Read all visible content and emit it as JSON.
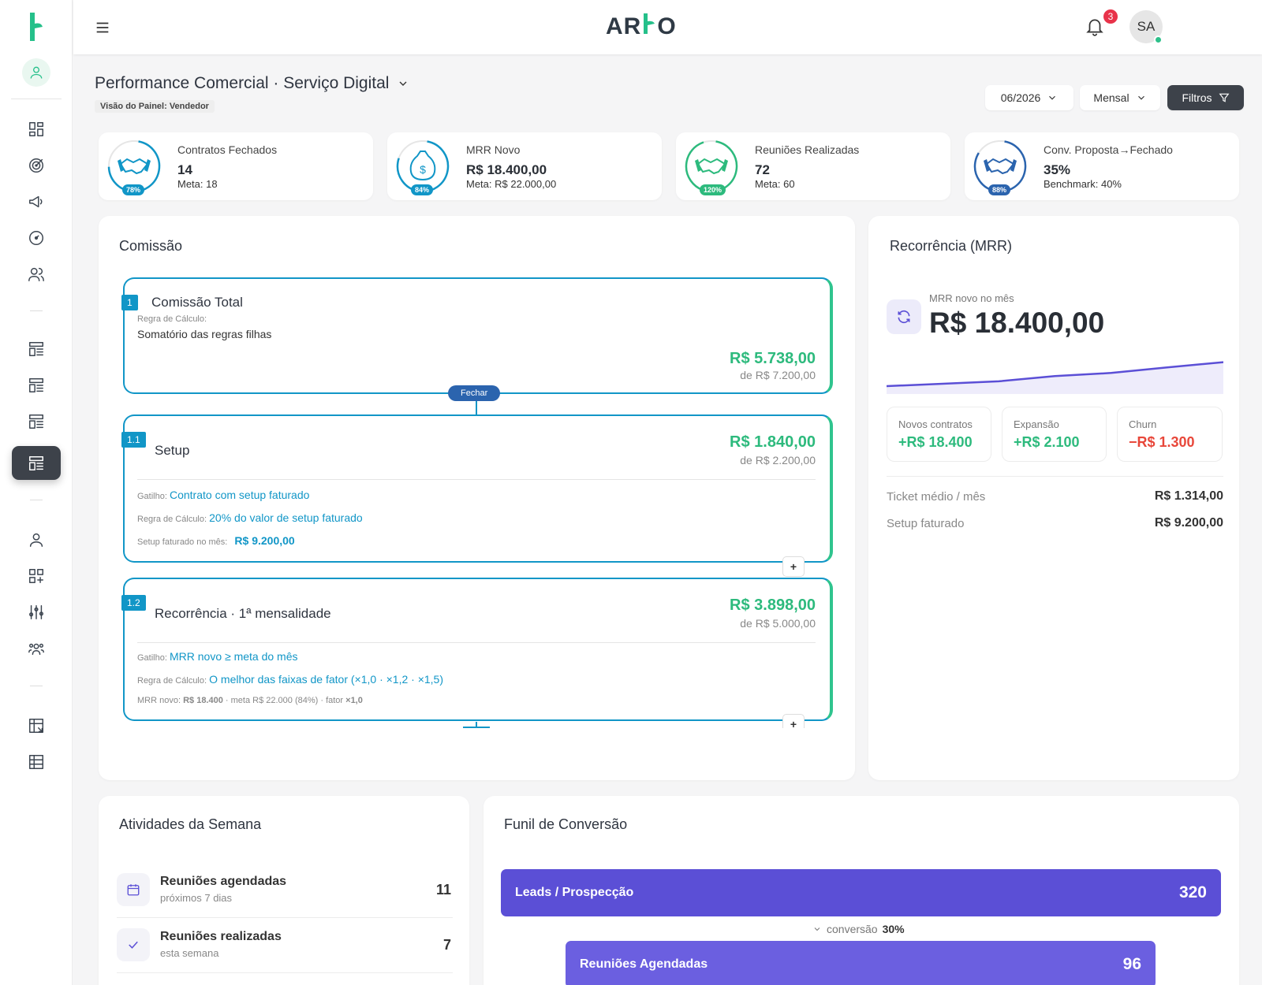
{
  "header": {
    "brand_left": "AR",
    "brand_right": "O",
    "notifications": "3",
    "user_initials": "SA"
  },
  "page": {
    "title": "Performance Comercial · Serviço Digital",
    "view_badge": "Visão do Painel: Vendedor",
    "period": "06/2026",
    "granularity": "Mensal",
    "filters_label": "Filtros"
  },
  "kpis": [
    {
      "label": "Contratos Fechados",
      "value": "14",
      "sub": "Meta: 18",
      "pct": "78%",
      "progress": 0.78,
      "color": "#1196c7"
    },
    {
      "label": "MRR Novo",
      "value": "R$ 18.400,00",
      "sub": "Meta: R$ 22.000,00",
      "pct": "84%",
      "progress": 0.84,
      "color": "#1196c7"
    },
    {
      "label": "Reuniões Realizadas",
      "value": "72",
      "sub": "Meta: 60",
      "pct": "120%",
      "progress": 1.0,
      "color": "#2dba7d"
    },
    {
      "label": "Conv. Proposta→Fechado",
      "value": "35%",
      "sub": "Benchmark: 40%",
      "pct": "88%",
      "progress": 0.88,
      "color": "#2b64ae"
    }
  ],
  "commission": {
    "title": "Comissão",
    "total": {
      "tag": "1",
      "name": "Comissão Total",
      "rule_label": "Regra de Cálculo:",
      "rule_text": "Somatório das regras filhas",
      "amount": "R$ 5.738,00",
      "of": "de R$ 7.200,00"
    },
    "close_label": "Fechar",
    "setup": {
      "tag": "1.1",
      "name": "Setup",
      "amount": "R$ 1.840,00",
      "of": "de R$ 2.200,00",
      "trigger_label": "Gatilho:",
      "trigger": "Contrato com setup faturado",
      "rule_label": "Regra de Cálculo:",
      "rule": "20% do valor de setup faturado",
      "billed_label": "Setup faturado no mês:",
      "billed": "R$ 9.200,00"
    },
    "recurring": {
      "tag": "1.2",
      "name": "Recorrência · 1ª mensalidade",
      "amount": "R$ 3.898,00",
      "of": "de R$ 5.000,00",
      "trigger_label": "Gatilho:",
      "trigger": "MRR novo ≥ meta do mês",
      "rule_label": "Regra de Cálculo:",
      "rule": "O melhor das faixas de fator (×1,0 · ×1,2 · ×1,5)",
      "detail_prefix": "MRR novo: ",
      "detail_mrr": "R$ 18.400",
      "detail_mid": " · meta R$ 22.000 (84%) · fator ",
      "detail_factor": "×1,0"
    },
    "plus": "+"
  },
  "mrr": {
    "title": "Recorrência (MRR)",
    "caption": "MRR novo no mês",
    "value": "R$ 18.400,00",
    "trend": [
      0.0,
      0.1,
      0.2,
      0.42,
      0.55,
      0.78,
      1.0
    ],
    "new_contracts_label": "Novos contratos",
    "new_contracts": "+R$ 18.400",
    "expansion_label": "Expansão",
    "expansion": "+R$ 2.100",
    "churn_label": "Churn",
    "churn": "−R$ 1.300",
    "ticket_label": "Ticket médio / mês",
    "ticket": "R$ 1.314,00",
    "setup_label": "Setup faturado",
    "setup": "R$ 9.200,00"
  },
  "activities": {
    "title": "Atividades da Semana",
    "items": [
      {
        "title": "Reuniões agendadas",
        "sub": "próximos 7 dias",
        "count": "11"
      },
      {
        "title": "Reuniões realizadas",
        "sub": "esta semana",
        "count": "7"
      }
    ]
  },
  "funnel": {
    "title": "Funil de Conversão",
    "stages": [
      {
        "label": "Leads / Prospecção",
        "value": "320",
        "color": "#5b4fd6"
      },
      {
        "label": "Reuniões Agendadas",
        "value": "96",
        "color": "#6b5fe0"
      }
    ],
    "conv_label": "conversão",
    "conv_value": "30%"
  }
}
